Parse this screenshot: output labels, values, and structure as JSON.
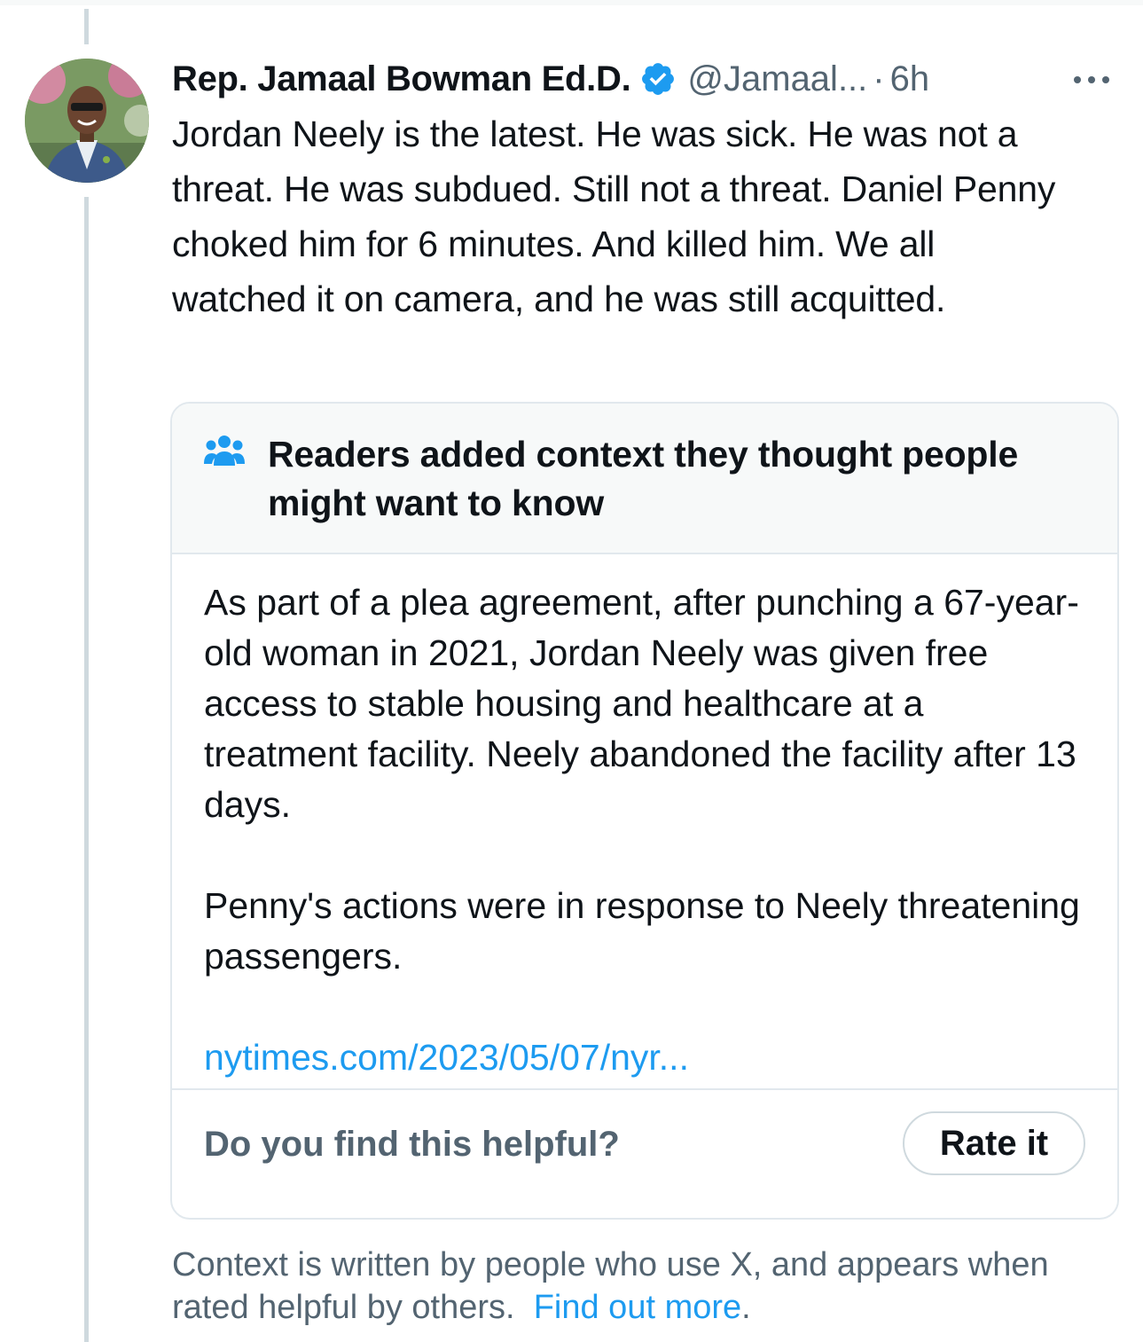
{
  "tweet": {
    "display_name": "Rep. Jamaal Bowman Ed.D.",
    "handle": "@Jamaal...",
    "separator": "·",
    "time": "6h",
    "text": "Jordan Neely is the latest. He was sick. He was not a threat. He was subdued. Still not a threat. Daniel Penny choked him for 6 minutes. And killed him. We all watched it on camera, and he was still acquitted."
  },
  "community_note": {
    "title": "Readers added context they thought people might want to know",
    "paragraphs": [
      "As part of a plea agreement, after punching a 67-year-old woman  in 2021, Jordan Neely was given free access to stable housing and healthcare at a treatment facility. Neely abandoned the facility after 13 days.",
      "Penny's actions were in response to Neely threatening passengers."
    ],
    "link_text": "nytimes.com/2023/05/07/nyr...",
    "helpful_question": "Do you find this helpful?",
    "rate_button_label": "Rate it"
  },
  "disclaimer": {
    "text": "Context is written by people who use X, and appears when rated helpful by others.",
    "link_text": "Find out more",
    "trailing": "."
  },
  "icons": {
    "verified": "verified-badge-icon",
    "more": "more-options-icon",
    "note": "people-group-icon"
  },
  "colors": {
    "link": "#1d9bf0",
    "secondary_text": "#536471",
    "primary_text": "#0f1419",
    "note_header_bg": "#f7f9f9",
    "border": "#e1e8ed"
  }
}
